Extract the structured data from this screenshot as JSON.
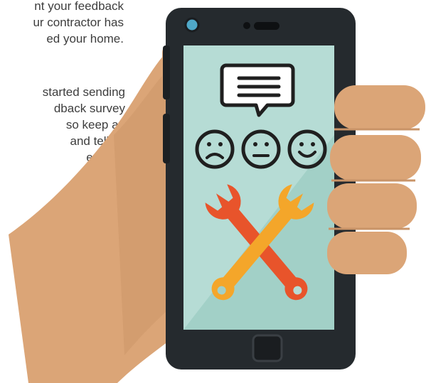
{
  "text": {
    "paragraph1": [
      "nt your feedback",
      "ur contractor has",
      "ed your home."
    ],
    "paragraph2": [
      "started sending",
      "dback survey",
      "so keep an",
      "and tell us",
      "e went."
    ]
  },
  "illustration": {
    "icons": [
      "speech-bubble-icon",
      "sad-face-icon",
      "neutral-face-icon",
      "happy-face-icon",
      "wrench-icon"
    ],
    "colors": {
      "skin": "#DBA577",
      "skin_shadow": "#C99468",
      "phone_body": "#252A2E",
      "phone_edge": "#3A3F44",
      "screen": "#B6DCD5",
      "screen_shade": "#A2D0C7",
      "icon_outline": "#1F1F1F",
      "wrench_orange": "#F4A62A",
      "wrench_red": "#E8542B",
      "camera": "#4FA8C8"
    }
  }
}
